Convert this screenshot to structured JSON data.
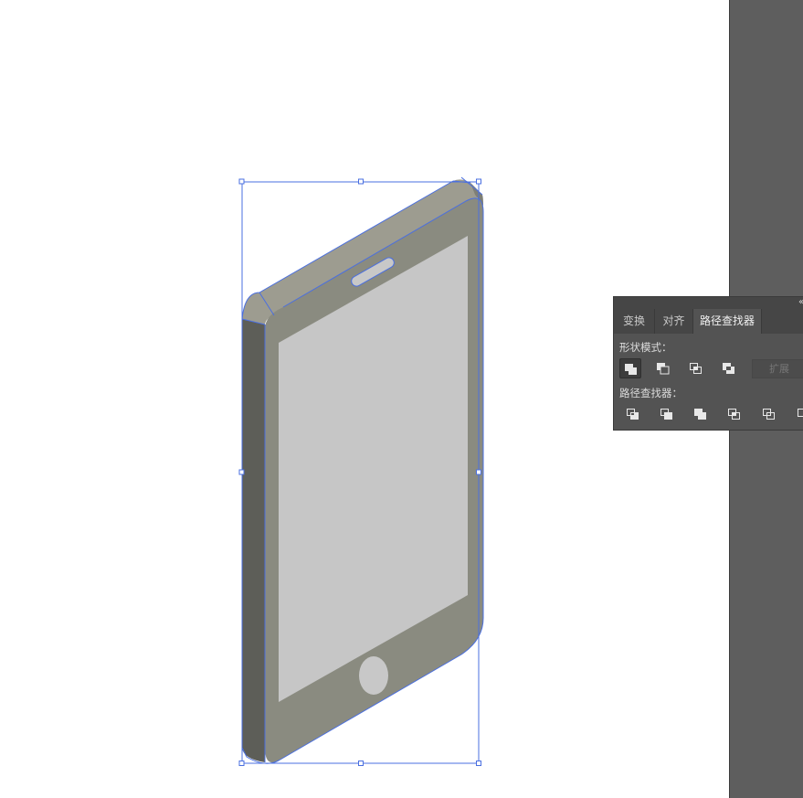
{
  "pathfinder_panel": {
    "tabs": [
      {
        "label": "变换",
        "active": false
      },
      {
        "label": "对齐",
        "active": false
      },
      {
        "label": "路径查找器",
        "active": true
      }
    ],
    "shape_modes_label": "形状模式：",
    "shape_mode_buttons": [
      "unite-icon",
      "minus-front-icon",
      "intersect-icon",
      "exclude-icon"
    ],
    "expand_label": "扩展",
    "pathfinders_label": "路径查找器：",
    "pathfinder_buttons": [
      "divide-icon",
      "trim-icon",
      "merge-icon",
      "crop-icon",
      "outline-icon",
      "minus-back-icon"
    ]
  },
  "artwork": {
    "subject": "isometric-phone",
    "colors": {
      "phone_face": "#8a8b80",
      "phone_side": "#5d5e58",
      "phone_top": "#9d9c90",
      "screen": "#c6c6c6",
      "selection": "#4a6fe0",
      "handle_fill": "#ffffff"
    }
  }
}
